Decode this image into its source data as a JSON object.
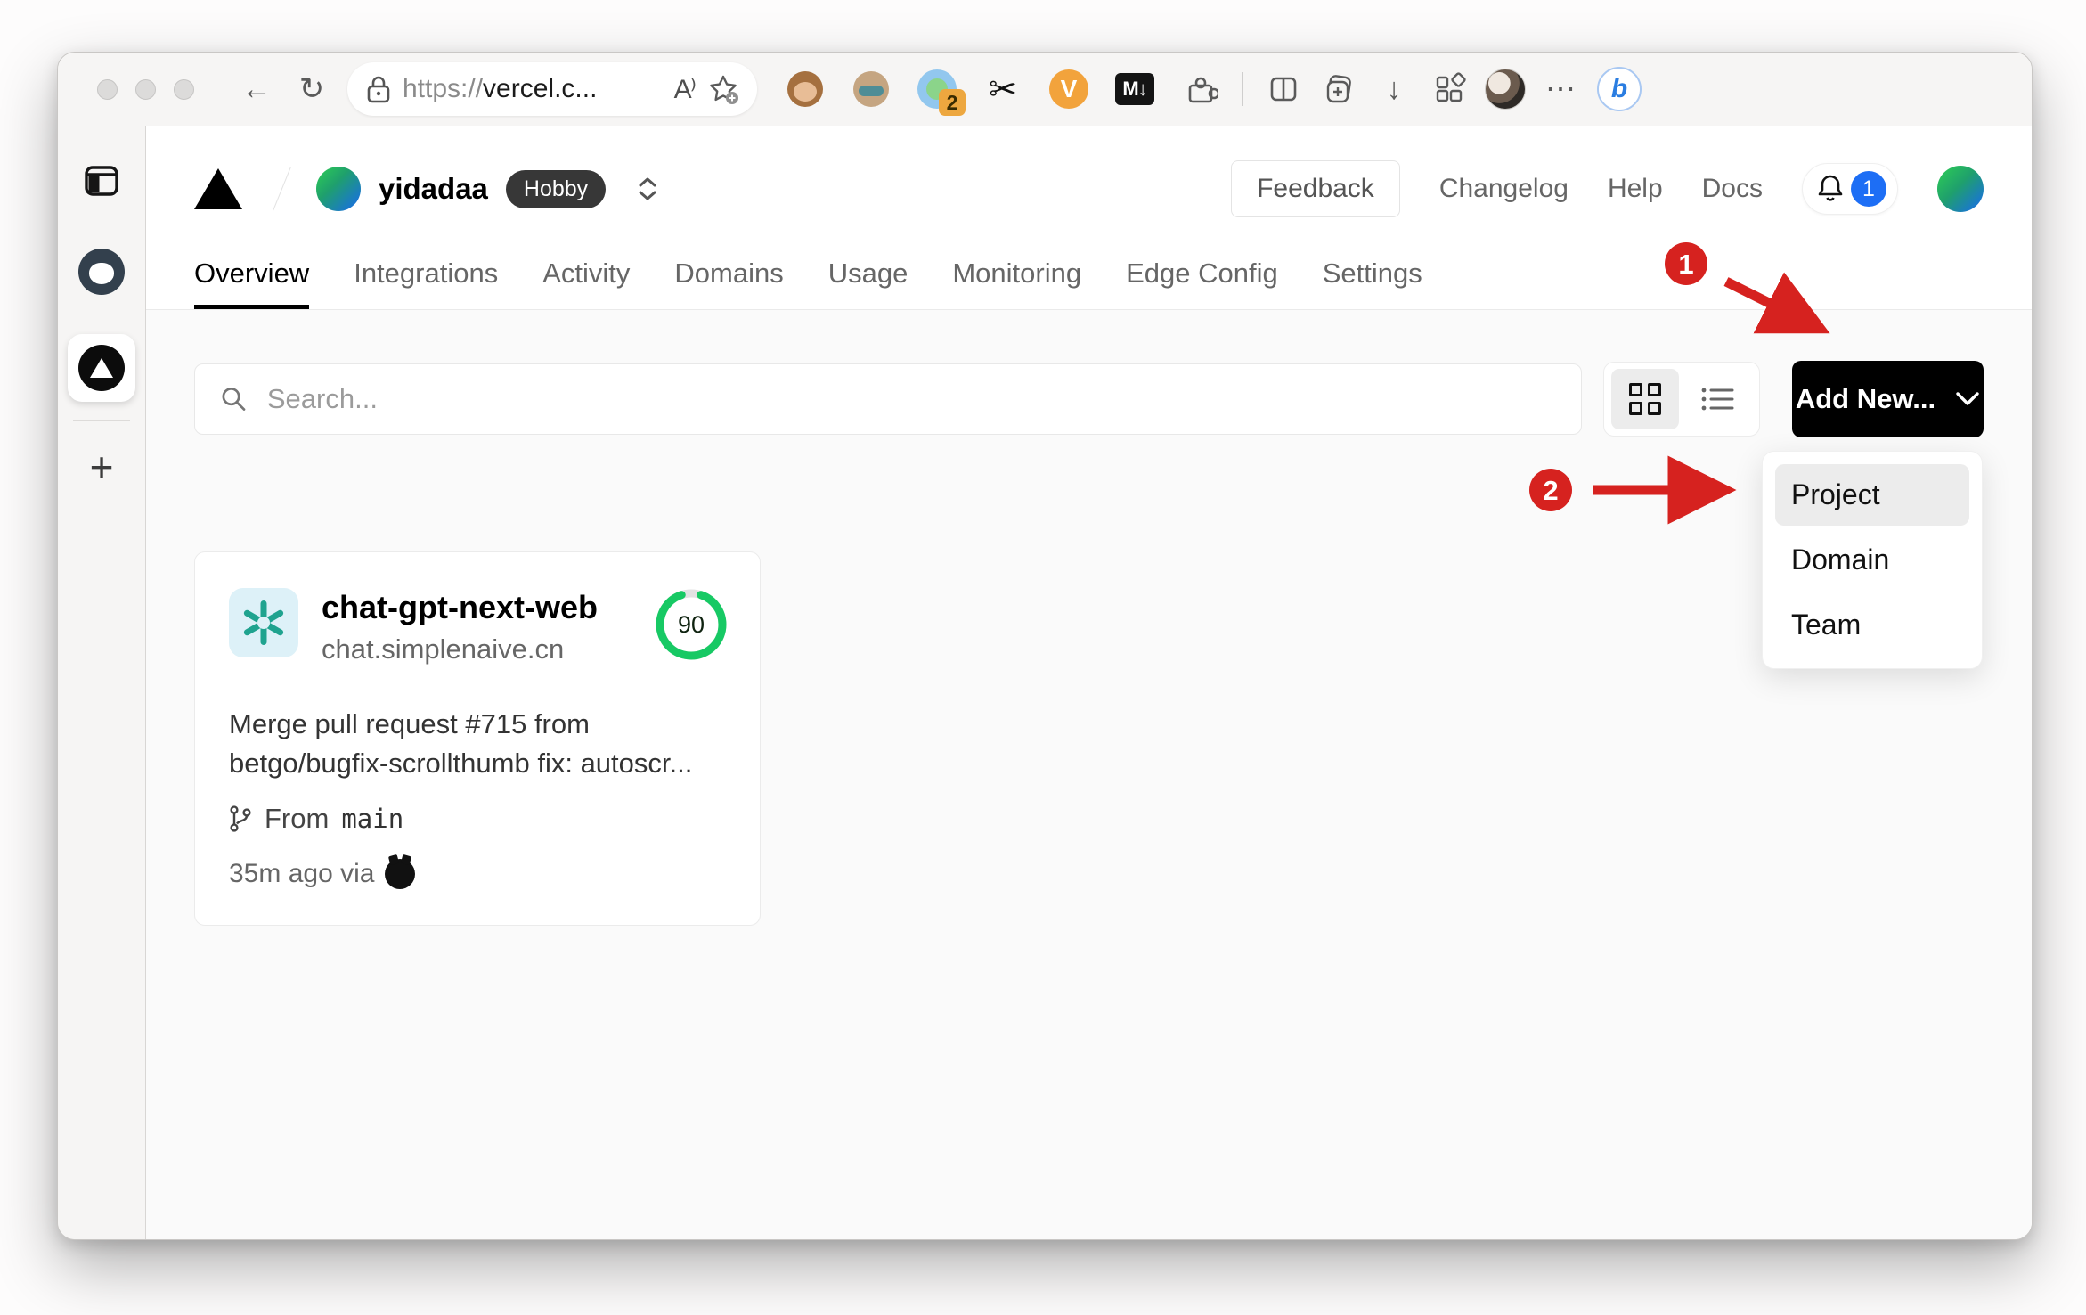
{
  "browser": {
    "url_scheme": "https://",
    "url_host": "vercel.c...",
    "read_aloud_glyph": "A⁾",
    "back_glyph": "←",
    "refresh_glyph": "↻",
    "download_glyph": "↓",
    "dots_glyph": "⋯",
    "scissors_glyph": "✂",
    "bing_glyph": "b",
    "extension_badge_count": "2",
    "extension_markdown_label": "M↓",
    "extension_v_label": "V",
    "new_tab_glyph": "+"
  },
  "vercel": {
    "team": {
      "name": "yidadaa",
      "plan_badge": "Hobby"
    },
    "header_links": {
      "feedback": "Feedback",
      "changelog": "Changelog",
      "help": "Help",
      "docs": "Docs"
    },
    "notifications": {
      "count": "1"
    },
    "tabs": [
      {
        "label": "Overview"
      },
      {
        "label": "Integrations"
      },
      {
        "label": "Activity"
      },
      {
        "label": "Domains"
      },
      {
        "label": "Usage"
      },
      {
        "label": "Monitoring"
      },
      {
        "label": "Edge Config"
      },
      {
        "label": "Settings"
      }
    ],
    "toolbar": {
      "search_placeholder": "Search...",
      "add_new_label": "Add New..."
    },
    "dropdown": {
      "items": [
        {
          "label": "Project"
        },
        {
          "label": "Domain"
        },
        {
          "label": "Team"
        }
      ]
    },
    "project_card": {
      "name": "chat-gpt-next-web",
      "domain": "chat.simplenaive.cn",
      "score": "90",
      "commit_message": "Merge pull request #715 from betgo/bugfix-scrollthumb fix: autoscr...",
      "branch_label": "From",
      "branch_name": "main",
      "deployed_meta": "35m ago via"
    },
    "annotations": {
      "step1": "1",
      "step2": "2"
    }
  },
  "colors": {
    "annotation_red": "#d6221f",
    "score_green": "#17c964",
    "accent_blue": "#1d6ef5",
    "openai_teal": "#1fa38f"
  }
}
